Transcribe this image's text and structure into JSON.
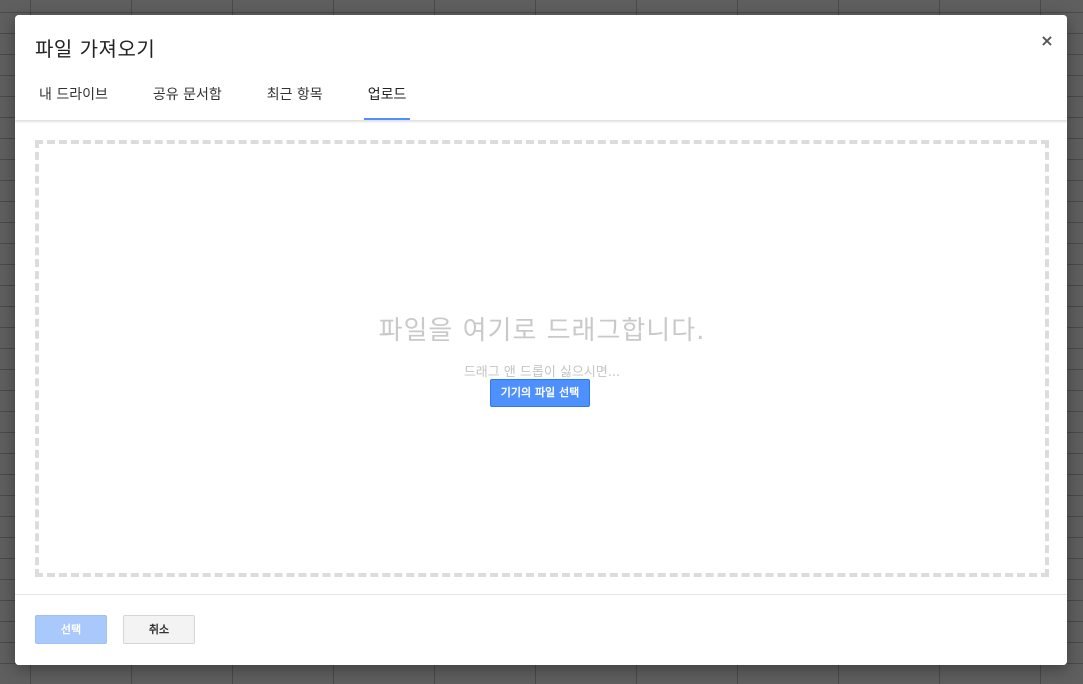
{
  "dialog": {
    "title": "파일 가져오기",
    "close_label": "×"
  },
  "tabs": [
    {
      "label": "내 드라이브",
      "active": false
    },
    {
      "label": "공유 문서함",
      "active": false
    },
    {
      "label": "최근 항목",
      "active": false
    },
    {
      "label": "업로드",
      "active": true
    }
  ],
  "dropzone": {
    "heading": "파일을 여기로 드래그합니다.",
    "subtext": "드래그 앤 드롭이 싫으시면...",
    "device_button_label": "기기의 파일 선택"
  },
  "footer": {
    "select_label": "선택",
    "select_enabled": false,
    "cancel_label": "취소"
  },
  "colors": {
    "accent": "#4d90fe",
    "select_disabled": "#a9c8fb",
    "backdrop": "#5f5f5f"
  },
  "icons": {
    "close": "close-icon"
  }
}
